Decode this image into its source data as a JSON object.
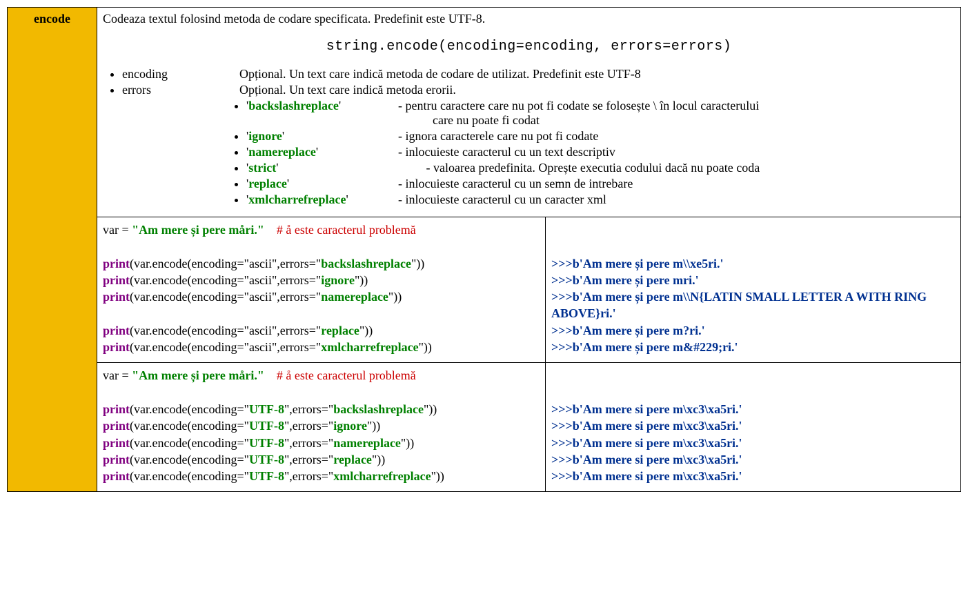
{
  "method_name": "encode",
  "description": "Codeaza textul folosind metoda de codare specificata. Predefinit este UTF-8.",
  "signature": "string.encode(encoding=encoding, errors=errors)",
  "params": {
    "encoding": {
      "key": "encoding",
      "desc": "Opțional. Un text care indică metoda de codare de utilizat. Predefinit este UTF-8"
    },
    "errors": {
      "key": "errors",
      "desc": "Opțional. Un text care indică metoda erorii.",
      "values": [
        {
          "name": "backslashreplace",
          "desc_a": "- pentru caractere care nu pot fi codate se folosește \\ în locul caracterului",
          "desc_b": "care nu poate fi codat"
        },
        {
          "name": "ignore",
          "desc_a": "- ignora caracterele care nu pot fi codate",
          "desc_b": ""
        },
        {
          "name": "namereplace",
          "desc_a": "- inlocuieste caracterul cu un text descriptiv",
          "desc_b": ""
        },
        {
          "name": "strict",
          "desc_a": "         - valoarea predefinita. Oprește executia codului dacă nu poate coda",
          "desc_b": ""
        },
        {
          "name": "replace",
          "desc_a": "- inlocuieste caracterul cu un semn de intrebare",
          "desc_b": ""
        },
        {
          "name": "xmlcharrefreplace",
          "desc_a": "- inlocuieste caracterul cu un caracter xml",
          "desc_b": ""
        }
      ]
    }
  },
  "example1": {
    "var_assign": {
      "pre": "var = ",
      "str": "\"Am mere și pere måri.\"",
      "comment": "# å este caracterul problemă"
    },
    "encoding_value": "ascii",
    "lines": [
      {
        "err": "backslashreplace",
        "out": "b'Am mere și pere m\\\\xe5ri.'"
      },
      {
        "err": "ignore",
        "out": "b'Am mere și pere mri.'"
      },
      {
        "err": "namereplace",
        "out": "b'Am mere și pere m\\\\N{LATIN SMALL LETTER A WITH RING ABOVE}ri.'"
      },
      {
        "err": "replace",
        "out": "b'Am mere și pere m?ri.'"
      },
      {
        "err": "xmlcharrefreplace",
        "out": "b'Am mere și pere m&#229;ri.'"
      }
    ]
  },
  "example2": {
    "var_assign": {
      "pre": "var = ",
      "str": "\"Am mere și pere måri.\"",
      "comment": "# å este caracterul problemă"
    },
    "encoding_value": "UTF-8",
    "lines": [
      {
        "err": "backslashreplace",
        "out": "b'Am mere si pere m\\xc3\\xa5ri.'"
      },
      {
        "err": "ignore",
        "out": "b'Am mere si pere m\\xc3\\xa5ri.'"
      },
      {
        "err": "namereplace",
        "out": "b'Am mere si pere m\\xc3\\xa5ri.'"
      },
      {
        "err": "replace",
        "out": "b'Am mere si pere m\\xc3\\xa5ri.'"
      },
      {
        "err": "xmlcharrefreplace",
        "out": "b'Am mere si pere m\\xc3\\xa5ri.'"
      }
    ]
  },
  "tokens": {
    "print": "print",
    "prompt": ">>>",
    "var_encode_open": "(var.encode(encoding=\"",
    "errors_open": "\",errors=\"",
    "close": "\"))",
    "quote": "'"
  }
}
